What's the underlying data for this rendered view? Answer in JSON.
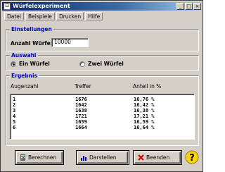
{
  "window": {
    "title": "Würfelexperiment",
    "minimize": "_",
    "maximize": "□",
    "close": "×"
  },
  "menu": [
    "Datei",
    "Beispiele",
    "Drucken",
    "Hilfe"
  ],
  "settings": {
    "legend": "Einstellungen",
    "throws_label": "Anzahl Würfe:",
    "throws_value": "10000"
  },
  "choice": {
    "legend": "Auswahl",
    "option_one": "Ein Würfel",
    "option_two": "Zwei Würfel",
    "selected": "option_one"
  },
  "result": {
    "legend": "Ergebnis",
    "columns": [
      "Augenzahl",
      "Treffer",
      "Anteil in %"
    ],
    "rows": [
      [
        "1",
        "1676",
        "16,76 %"
      ],
      [
        "2",
        "1642",
        "16,42 %"
      ],
      [
        "3",
        "1638",
        "16,38 %"
      ],
      [
        "4",
        "1721",
        "17,21 %"
      ],
      [
        "5",
        "1659",
        "16,59 %"
      ],
      [
        "6",
        "1664",
        "16,64 %"
      ]
    ]
  },
  "buttons": {
    "compute": "Berechnen",
    "display": "Darstellen",
    "quit": "Beenden"
  },
  "icons": [
    "calculator-icon",
    "chart-icon",
    "close-x-icon",
    "help-question-icon"
  ],
  "colors": {
    "title_bar": "#0a246a",
    "legend_text": "#0000c0",
    "quit_icon": "#cc0000"
  }
}
